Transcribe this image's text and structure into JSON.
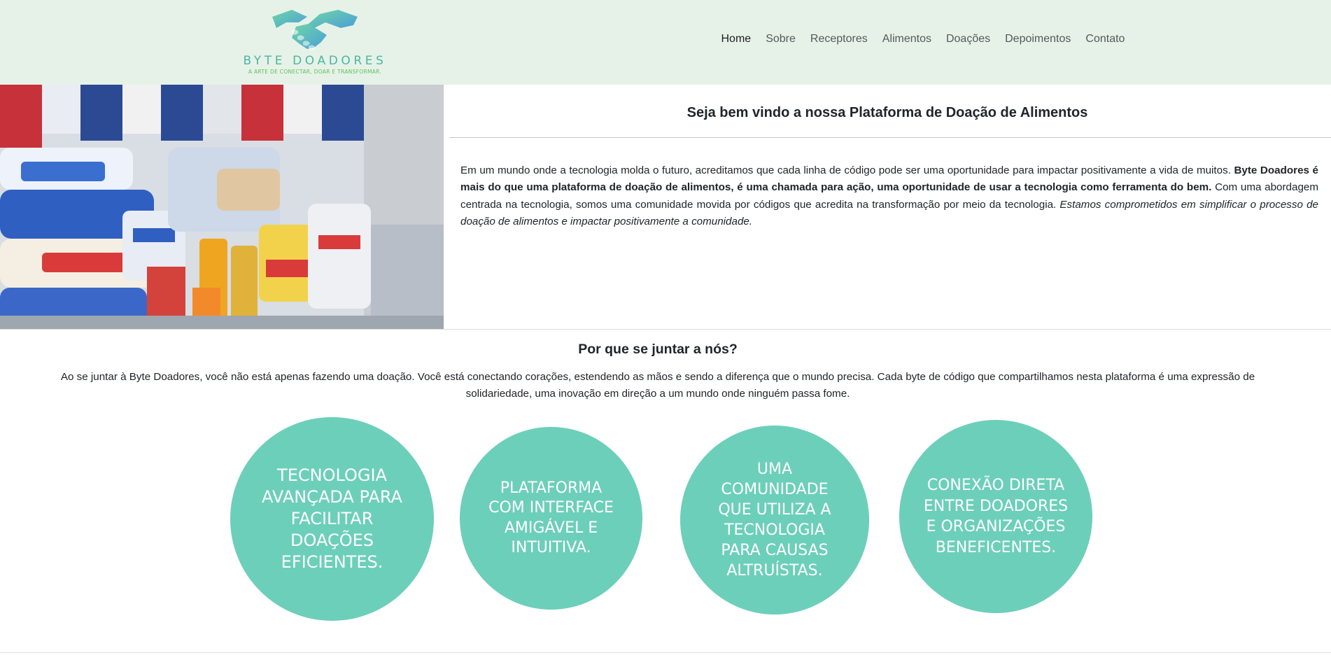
{
  "brand": {
    "name": "BYTE DOADORES",
    "tagline": "A ARTE DE CONECTAR, DOAR E TRANSFORMAR.",
    "colors": {
      "teal": "#6ccfba",
      "header_bg": "#e6f2e8",
      "logo_text": "#4cb6a0"
    }
  },
  "nav": {
    "items": [
      {
        "label": "Home",
        "active": true
      },
      {
        "label": "Sobre"
      },
      {
        "label": "Receptores"
      },
      {
        "label": "Alimentos"
      },
      {
        "label": "Doações"
      },
      {
        "label": "Depoimentos"
      },
      {
        "label": "Contato"
      }
    ]
  },
  "hero": {
    "image_icon": "food-donation-photo",
    "title": "Seja bem vindo a nossa Plataforma de Doação de Alimentos",
    "text_1": "Em um mundo onde a tecnologia molda o futuro, acreditamos que cada linha de código pode ser uma oportunidade para impactar positivamente a vida de muitos. ",
    "text_bold": "Byte Doadores é mais do que uma plataforma de doação de alimentos, é uma chamada para ação, uma oportunidade de usar a tecnologia como ferramenta do bem.",
    "text_2": " Com uma abordagem centrada na tecnologia, somos uma comunidade movida por códigos que acredita na transformação por meio da tecnologia. ",
    "text_italic": "Estamos comprometidos em simplificar o processo de doação de alimentos e impactar positivamente a comunidade."
  },
  "why": {
    "title": "Por que se juntar a nós?",
    "text": "Ao se juntar à Byte Doadores, você não está apenas fazendo uma doação. Você está conectando corações, estendendo as mãos e sendo a diferença que o mundo precisa. Cada byte de código que compartilhamos nesta plataforma é uma expressão de solidariedade, uma inovação em direção a um mundo onde ninguém passa fome."
  },
  "features": [
    {
      "text": "TECNOLOGIA AVANÇADA PARA FACILITAR DOAÇÕES EFICIENTES."
    },
    {
      "text": "PLATAFORMA COM INTERFACE AMIGÁVEL E INTUITIVA."
    },
    {
      "text": "UMA COMUNIDADE QUE UTILIZA A TECNOLOGIA PARA CAUSAS ALTRUÍSTAS."
    },
    {
      "text": "CONEXÃO DIRETA ENTRE DOADORES E ORGANIZAÇÕES BENEFICENTES."
    }
  ]
}
